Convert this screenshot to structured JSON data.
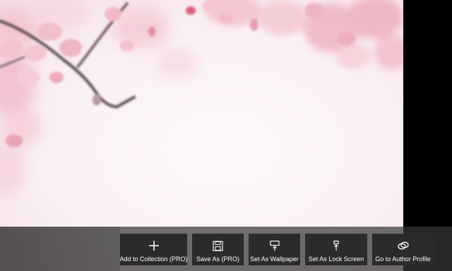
{
  "photo": {
    "subject": "cherry-blossom-photo"
  },
  "app_bar": {
    "commands": [
      {
        "label": "Add to Collection (PRO)",
        "icon": "plus-icon"
      },
      {
        "label": "Save As (PRO)",
        "icon": "save-icon"
      },
      {
        "label": "Set As Wallpaper",
        "icon": "wallpaper-icon"
      },
      {
        "label": "Set As Lock Screen",
        "icon": "lock-screen-icon"
      },
      {
        "label": "Go to Author Profile",
        "icon": "link-icon"
      }
    ]
  },
  "colors": {
    "button_bg": "#2b2b2b",
    "bar_bg": "#373737",
    "blossom": "#f2b9c8",
    "branch": "#5a4a4e"
  }
}
